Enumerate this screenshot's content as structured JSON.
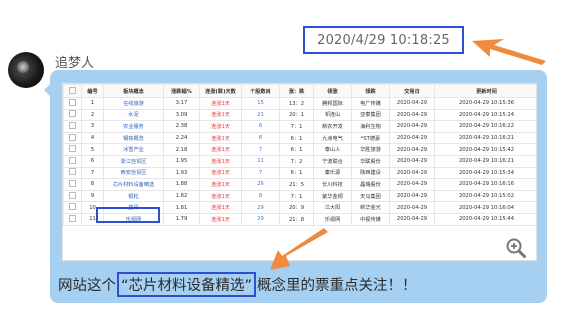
{
  "timestamp": "2020/4/29 10:18:25",
  "sender": "追梦人",
  "table": {
    "columns": [
      "",
      "编号",
      "板块概念",
      "涨跌幅%",
      "连涨(跌)天数",
      "个股数目",
      "涨：跌",
      "领涨",
      "领跌",
      "交易日",
      "更新时间"
    ],
    "rows": [
      [
        "",
        "1",
        "在线旅游",
        "3.17",
        "连涨1天",
        "15",
        "13：2",
        "腾邦国际",
        "电广传媒",
        "2020-04-29",
        "2020-04-29 10:15:36"
      ],
      [
        "",
        "2",
        "水泥",
        "3.09",
        "连涨1天",
        "21",
        "20：1",
        "祁连山",
        "亚泰集团",
        "2020-04-29",
        "2020-04-29 10:15:24"
      ],
      [
        "",
        "3",
        "农业服务",
        "2.38",
        "连涨1天",
        "6",
        "7：1",
        "新农开发",
        "海利生物",
        "2020-04-29",
        "2020-04-29 10:16:22"
      ],
      [
        "",
        "4",
        "钢铁概念",
        "2.24",
        "连涨1天",
        "6",
        "6：1",
        "九洲电气",
        "*ST德豪",
        "2020-04-29",
        "2020-04-29 10:16:21"
      ],
      [
        "",
        "5",
        "冰雪产业",
        "2.18",
        "连涨1天",
        "7",
        "6：1",
        "泰山人",
        "华胜旅游",
        "2020-04-29",
        "2020-04-29 10:15:42"
      ],
      [
        "",
        "6",
        "浙江自贸区",
        "1.95",
        "连涨1天",
        "11",
        "7：2",
        "宁波联合",
        "华联股份",
        "2020-04-29",
        "2020-04-29 10:16:21"
      ],
      [
        "",
        "7",
        "西安自贸区",
        "1.93",
        "连涨1天",
        "7",
        "6：1",
        "秦乐源",
        "陕西建设",
        "2020-04-29",
        "2020-04-29 10:15:34"
      ],
      [
        "",
        "8",
        "芯片材料设备精选",
        "1.88",
        "连涨1天",
        "26",
        "21：5",
        "长川科技",
        "晶瑞股份",
        "2020-04-29",
        "2020-04-29 10:16:16"
      ],
      [
        "",
        "9",
        "铜粒",
        "1.82",
        "连涨1天",
        "8",
        "7：1",
        "紫华金铜",
        "天马集团",
        "2020-04-29",
        "2020-04-29 10:15:02"
      ],
      [
        "",
        "10",
        "蓝牙",
        "1.81",
        "连涨1天",
        "29",
        "20：9",
        "江大阳",
        "新华金光",
        "2020-04-29",
        "2020-04-29 10:16:04"
      ],
      [
        "",
        "11",
        "乐视网",
        "1.79",
        "连涨1天",
        "29",
        "21：8",
        "乐视网",
        "中视传媒",
        "2020-04-29",
        "2020-04-29 10:15:44"
      ]
    ]
  },
  "caption": {
    "before": "网站这个",
    "quoted": "“芯片材料设备精选”",
    "after": "概念里的票重点关注！！"
  },
  "colors": {
    "bubble": "#a6d0f2",
    "highlight_box": "#2f4fd1",
    "arrow": "#f08a3c",
    "rise": "#e4393c",
    "link": "#2f5fb3"
  },
  "icons": {
    "zoom": "zoom-in-icon",
    "arrow": "pointer-arrow-icon"
  }
}
